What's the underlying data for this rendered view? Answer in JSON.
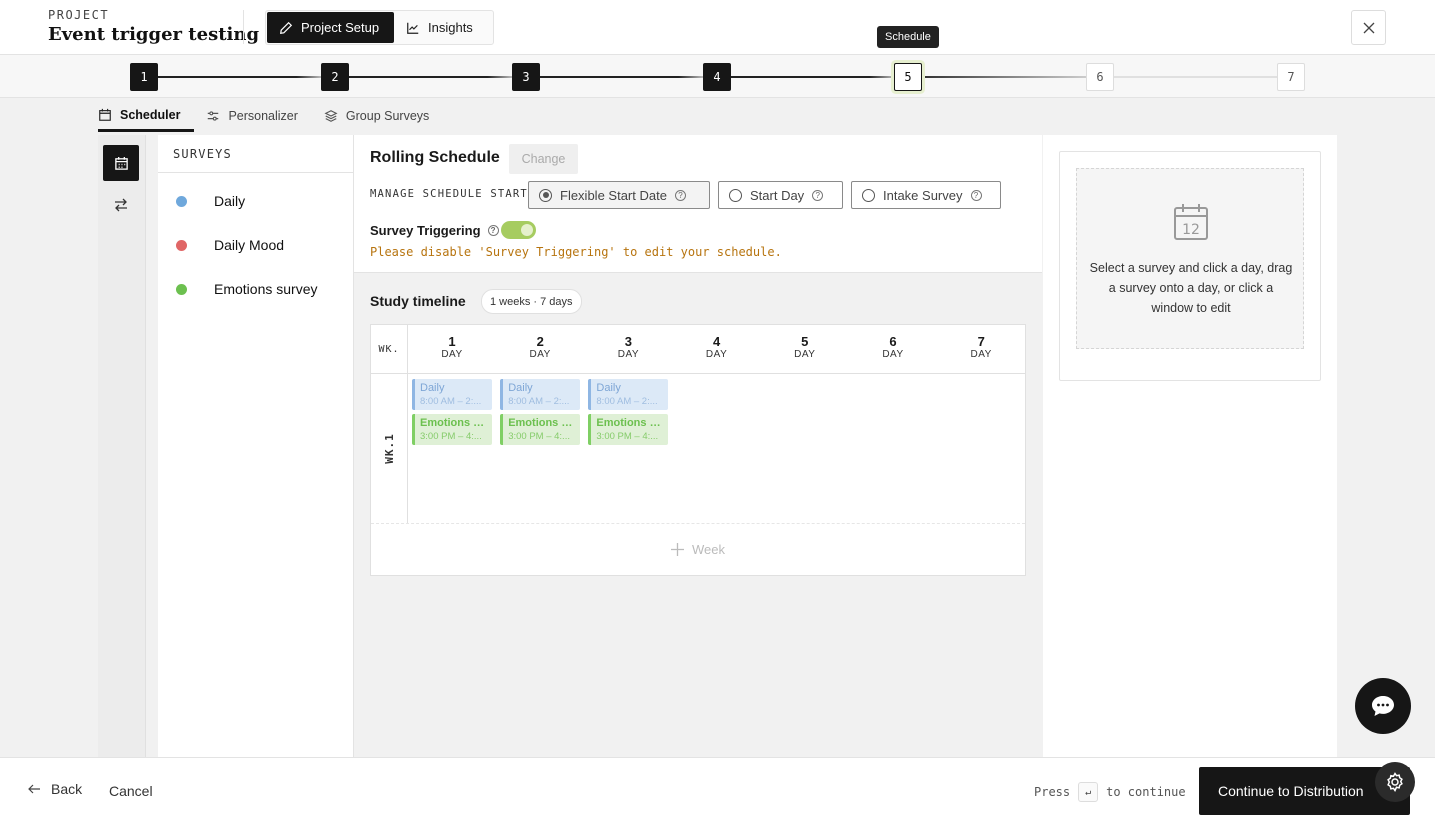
{
  "header": {
    "project_label": "PROJECT",
    "project_name": "Event trigger testing",
    "tabs": [
      {
        "label": "Project Setup",
        "icon": "pencil-icon"
      },
      {
        "label": "Insights",
        "icon": "line-chart-icon"
      }
    ]
  },
  "stepper": {
    "steps": [
      "1",
      "2",
      "3",
      "4",
      "5",
      "6",
      "7"
    ],
    "current": 5,
    "tooltip": "Schedule"
  },
  "subtabs": [
    {
      "label": "Scheduler",
      "icon": "calendar-icon"
    },
    {
      "label": "Personalizer",
      "icon": "sliders-icon"
    },
    {
      "label": "Group Surveys",
      "icon": "layers-icon"
    }
  ],
  "surveys": {
    "title": "SURVEYS",
    "items": [
      {
        "name": "Daily",
        "color": "#6fa8dc"
      },
      {
        "name": "Daily Mood",
        "color": "#e06666"
      },
      {
        "name": "Emotions survey",
        "color": "#6cc04f"
      }
    ]
  },
  "schedule": {
    "title": "Rolling Schedule",
    "change_label": "Change",
    "manage_label": "MANAGE SCHEDULE START",
    "options": [
      "Flexible Start Date",
      "Start Day",
      "Intake Survey"
    ],
    "selected_option": "Flexible Start Date",
    "triggering_label": "Survey Triggering",
    "triggering_on": true,
    "warning": "Please disable 'Survey Triggering' to edit your schedule."
  },
  "timeline": {
    "title": "Study timeline",
    "badge": "1 weeks · 7 days",
    "wk_header": "WK.",
    "day_label": "DAY",
    "days": [
      "1",
      "2",
      "3",
      "4",
      "5",
      "6",
      "7"
    ],
    "week_label": "WK.1",
    "events": [
      {
        "day": 1,
        "name": "Daily",
        "time": "8:00 AM – 2:...",
        "color": "blue"
      },
      {
        "day": 1,
        "name": "Emotions s...",
        "time": "3:00 PM – 4:...",
        "color": "green"
      },
      {
        "day": 2,
        "name": "Daily",
        "time": "8:00 AM – 2:...",
        "color": "blue"
      },
      {
        "day": 2,
        "name": "Emotions s...",
        "time": "3:00 PM – 4:...",
        "color": "green"
      },
      {
        "day": 3,
        "name": "Daily",
        "time": "8:00 AM – 2:...",
        "color": "blue"
      },
      {
        "day": 3,
        "name": "Emotions s...",
        "time": "3:00 PM – 4:...",
        "color": "green"
      }
    ],
    "add_week_label": "Week"
  },
  "right_panel": {
    "icon_day": "12",
    "hint": "Select a survey and click a day, drag a survey onto a day, or click a window to edit"
  },
  "footer": {
    "back_label": "Back",
    "cancel_label": "Cancel",
    "press_label": "Press",
    "key_label": "↵",
    "continue_hint": "to continue",
    "continue_button": "Continue to Distribution"
  }
}
